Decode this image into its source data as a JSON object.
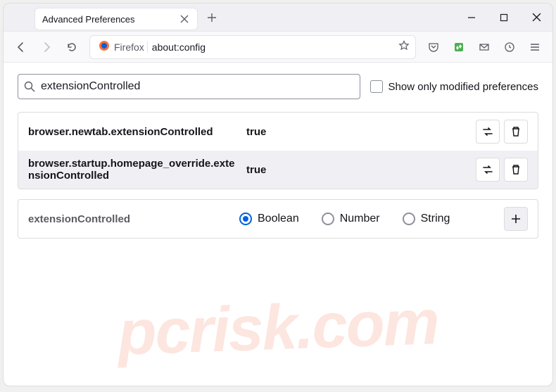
{
  "window": {
    "tab_title": "Advanced Preferences",
    "identity_label": "Firefox",
    "url": "about:config"
  },
  "config": {
    "search_value": "extensionControlled",
    "show_only_modified_label": "Show only modified preferences",
    "prefs": [
      {
        "name": "browser.newtab.extensionControlled",
        "value": "true"
      },
      {
        "name": "browser.startup.homepage_override.extensionControlled",
        "value": "true"
      }
    ],
    "new_pref_name": "extensionControlled",
    "type_options": {
      "boolean": "Boolean",
      "number": "Number",
      "string": "String"
    }
  },
  "watermark": "pcrisk.com"
}
